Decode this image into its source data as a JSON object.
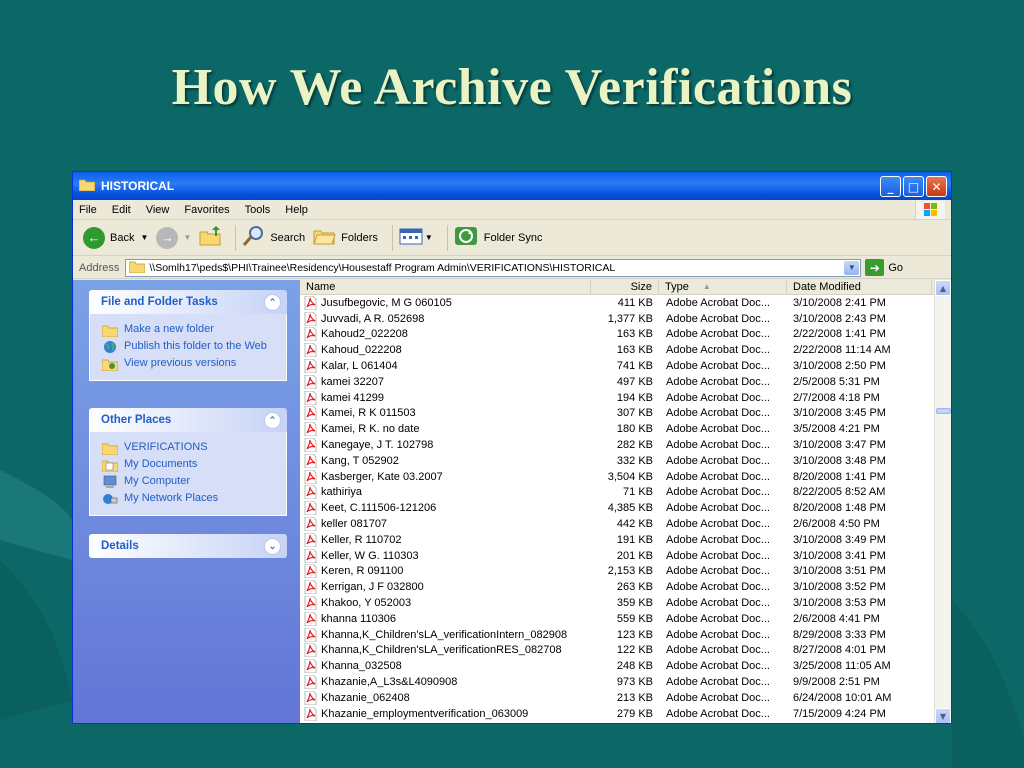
{
  "slide": {
    "title": "How We Archive Verifications"
  },
  "window": {
    "title": "HISTORICAL",
    "menu": [
      "File",
      "Edit",
      "View",
      "Favorites",
      "Tools",
      "Help"
    ],
    "toolbar": {
      "back": "Back",
      "search": "Search",
      "folders": "Folders",
      "folder_sync": "Folder Sync"
    },
    "address": {
      "label": "Address",
      "path": "\\\\Somlh17\\peds$\\PHI\\Trainee\\Residency\\Housestaff Program Admin\\VERIFICATIONS\\HISTORICAL",
      "go": "Go"
    }
  },
  "left_pane": {
    "tasks": {
      "title": "File and Folder Tasks",
      "items": [
        "Make a new folder",
        "Publish this folder to the Web",
        "View previous versions"
      ]
    },
    "places": {
      "title": "Other Places",
      "items": [
        "VERIFICATIONS",
        "My Documents",
        "My Computer",
        "My Network Places"
      ]
    },
    "details": {
      "title": "Details"
    }
  },
  "file_list": {
    "columns": [
      "Name",
      "Size",
      "Type",
      "Date Modified"
    ],
    "rows": [
      [
        "Jusufbegovic, M G 060105",
        "411 KB",
        "Adobe Acrobat Doc...",
        "3/10/2008 2:41 PM"
      ],
      [
        "Juvvadi, A R. 052698",
        "1,377 KB",
        "Adobe Acrobat Doc...",
        "3/10/2008 2:43 PM"
      ],
      [
        "Kahoud2_022208",
        "163 KB",
        "Adobe Acrobat Doc...",
        "2/22/2008 1:41 PM"
      ],
      [
        "Kahoud_022208",
        "163 KB",
        "Adobe Acrobat Doc...",
        "2/22/2008 11:14 AM"
      ],
      [
        "Kalar, L 061404",
        "741 KB",
        "Adobe Acrobat Doc...",
        "3/10/2008 2:50 PM"
      ],
      [
        "kamei 32207",
        "497 KB",
        "Adobe Acrobat Doc...",
        "2/5/2008 5:31 PM"
      ],
      [
        "kamei 41299",
        "194 KB",
        "Adobe Acrobat Doc...",
        "2/7/2008 4:18 PM"
      ],
      [
        "Kamei, R K 011503",
        "307 KB",
        "Adobe Acrobat Doc...",
        "3/10/2008 3:45 PM"
      ],
      [
        "Kamei, R K. no date",
        "180 KB",
        "Adobe Acrobat Doc...",
        "3/5/2008 4:21 PM"
      ],
      [
        "Kanegaye, J T. 102798",
        "282 KB",
        "Adobe Acrobat Doc...",
        "3/10/2008 3:47 PM"
      ],
      [
        "Kang, T 052902",
        "332 KB",
        "Adobe Acrobat Doc...",
        "3/10/2008 3:48 PM"
      ],
      [
        "Kasberger, Kate 03.2007",
        "3,504 KB",
        "Adobe Acrobat Doc...",
        "8/20/2008 1:41 PM"
      ],
      [
        "kathiriya",
        "71 KB",
        "Adobe Acrobat Doc...",
        "8/22/2005 8:52 AM"
      ],
      [
        "Keet, C.111506-121206",
        "4,385 KB",
        "Adobe Acrobat Doc...",
        "8/20/2008 1:48 PM"
      ],
      [
        "keller 081707",
        "442 KB",
        "Adobe Acrobat Doc...",
        "2/6/2008 4:50 PM"
      ],
      [
        "Keller, R 110702",
        "191 KB",
        "Adobe Acrobat Doc...",
        "3/10/2008 3:49 PM"
      ],
      [
        "Keller, W G. 110303",
        "201 KB",
        "Adobe Acrobat Doc...",
        "3/10/2008 3:41 PM"
      ],
      [
        "Keren, R 091100",
        "2,153 KB",
        "Adobe Acrobat Doc...",
        "3/10/2008 3:51 PM"
      ],
      [
        "Kerrigan, J F 032800",
        "263 KB",
        "Adobe Acrobat Doc...",
        "3/10/2008 3:52 PM"
      ],
      [
        "Khakoo, Y 052003",
        "359 KB",
        "Adobe Acrobat Doc...",
        "3/10/2008 3:53 PM"
      ],
      [
        "khanna 110306",
        "559 KB",
        "Adobe Acrobat Doc...",
        "2/6/2008 4:41 PM"
      ],
      [
        "Khanna,K_Children'sLA_verificationIntern_082908",
        "123 KB",
        "Adobe Acrobat Doc...",
        "8/29/2008 3:33 PM"
      ],
      [
        "Khanna,K_Children'sLA_verificationRES_082708",
        "122 KB",
        "Adobe Acrobat Doc...",
        "8/27/2008 4:01 PM"
      ],
      [
        "Khanna_032508",
        "248 KB",
        "Adobe Acrobat Doc...",
        "3/25/2008 11:05 AM"
      ],
      [
        "Khazanie,A_L3s&L4090908",
        "973 KB",
        "Adobe Acrobat Doc...",
        "9/9/2008 2:51 PM"
      ],
      [
        "Khazanie_062408",
        "213 KB",
        "Adobe Acrobat Doc...",
        "6/24/2008 10:01 AM"
      ],
      [
        "Khazanie_employmentverification_063009",
        "279 KB",
        "Adobe Acrobat Doc...",
        "7/15/2009 4:24 PM"
      ]
    ]
  },
  "colors": {
    "slide_bg": "#0c6767",
    "title_text": "#e9f3c4",
    "xp_blue": "#0a5fec",
    "task_link": "#215dc6"
  }
}
